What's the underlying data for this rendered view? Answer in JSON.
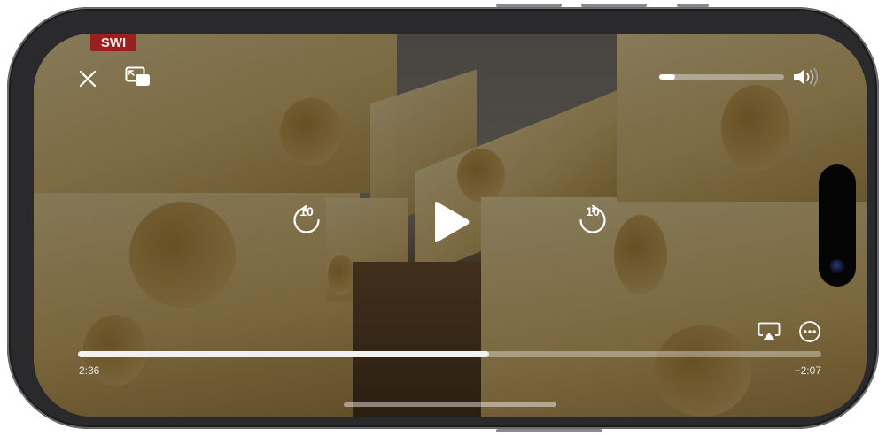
{
  "video": {
    "watermark": "SWI",
    "colors": {
      "overlay": "#000000",
      "accent": "#ffffff",
      "watermark_bg": "#9a2020"
    }
  },
  "controls": {
    "close_icon": "close-icon",
    "pip_icon": "picture-in-picture-icon",
    "volume_icon": "speaker-volume-icon",
    "volume_level": 0.13,
    "skip_back_label": "10",
    "skip_forward_label": "10",
    "play_icon": "play-icon",
    "airplay_icon": "airplay-icon",
    "more_icon": "more-options-icon",
    "elapsed_time": "2:36",
    "remaining_time": "−2:07",
    "progress": 0.553
  }
}
